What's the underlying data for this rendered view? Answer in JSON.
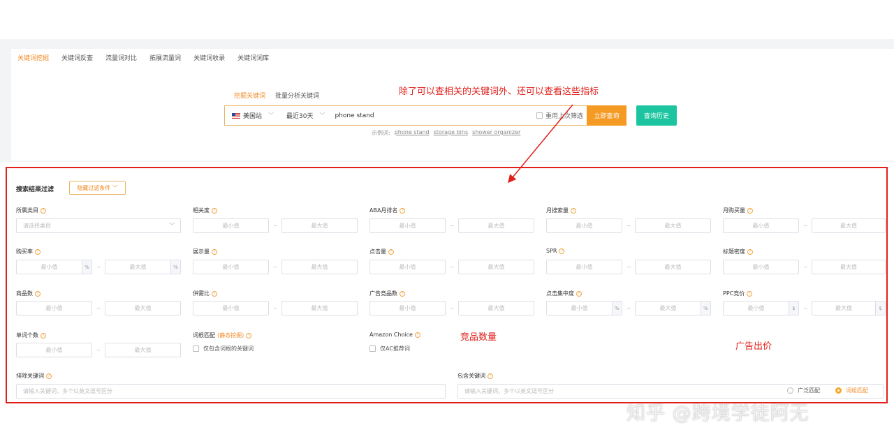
{
  "tabs": [
    "关键词挖掘",
    "关键词反查",
    "流量词对比",
    "拓展流量词",
    "关键词收录",
    "关键词词库"
  ],
  "active_tab": 0,
  "search_modes": [
    "挖掘关键词",
    "批量分析关键词"
  ],
  "search": {
    "site": "美国站",
    "period": "最近30天",
    "keyword": "phone stand",
    "reuse_label": "重用上次筛选",
    "query_button": "立即查询",
    "history_button": "查询历史"
  },
  "examples": {
    "label": "示例词:",
    "items": [
      "phone stand",
      "storage bins",
      "shower organizer"
    ]
  },
  "annotations": {
    "top": "除了可以查相关的关键词外、还可以查看这些指标",
    "competitors": "竞品数量",
    "ad_bid": "广告出价"
  },
  "filter": {
    "title": "搜索结果过滤",
    "hide_button": "隐藏过滤条件",
    "min": "最小值",
    "max": "最大值",
    "category_placeholder": "请选择类目",
    "fields": {
      "category": "所属类目",
      "relevance": "相关度",
      "aba_rank": "ABA月排名",
      "monthly_search": "月搜索量",
      "monthly_purchase": "月购买量",
      "purchase_rate": "购买率",
      "impressions": "展示量",
      "clicks": "点击量",
      "spr": "SPR",
      "title_density": "标题密度",
      "products": "商品数",
      "supply_ratio": "供需比",
      "ad_products": "广告竞品数",
      "click_concentration": "点击集中度",
      "ppc_bid": "PPC竞价",
      "word_count": "单词个数",
      "root_match": "词根匹配",
      "root_match_tag": "(静态挖掘)",
      "root_only": "仅包含词根的关键词",
      "amazon_choice": "Amazon Choice",
      "ac_only": "仅AC推荐词",
      "exclude_kw": "排除关键词",
      "include_kw": "包含关键词"
    },
    "kw_placeholder": "请输入关键词，多个以英文逗号区分",
    "match_options": [
      "广泛匹配",
      "词组匹配"
    ],
    "selected_match": 1,
    "units": {
      "percent": "%",
      "dollar": "$"
    }
  },
  "watermark": "知乎 @跨境学徒阿无",
  "colors": {
    "accent": "#f08a24",
    "teal": "#1cc5a0",
    "annotation_red": "#e0201b"
  }
}
